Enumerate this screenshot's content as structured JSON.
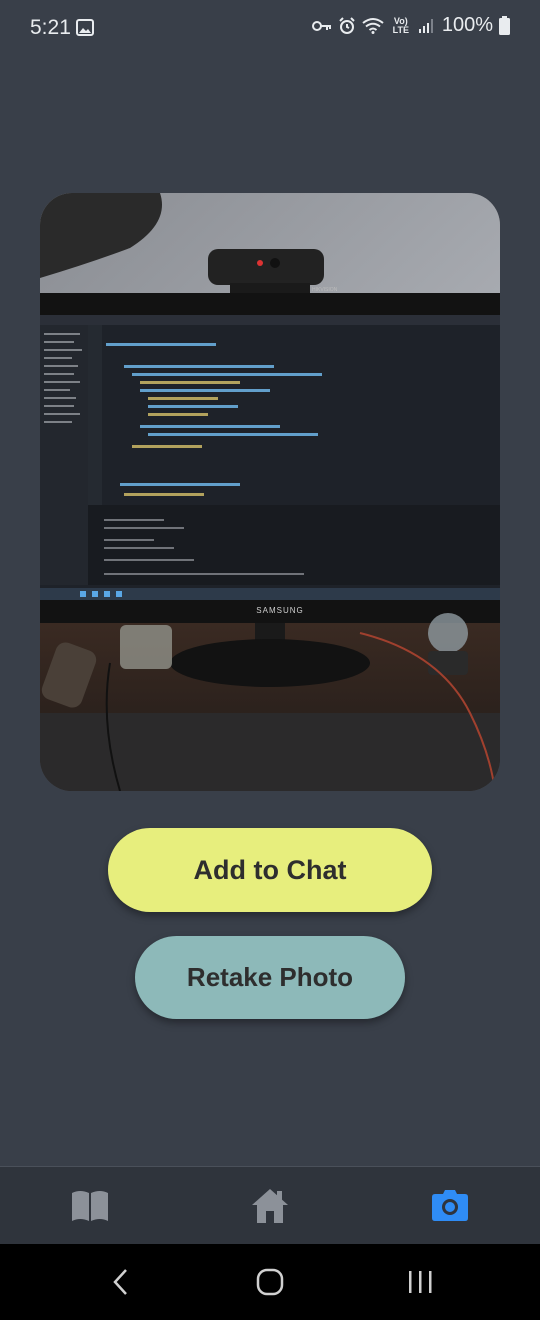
{
  "status_bar": {
    "time": "5:21",
    "network_label": "Vo) LTE",
    "battery_percent": "100%"
  },
  "photo": {
    "monitor_brand": "SAMSUNG",
    "webcam_brand": "HIKVISION"
  },
  "actions": {
    "add_to_chat": "Add to Chat",
    "retake_photo": "Retake Photo"
  },
  "tab_bar": {
    "tabs": [
      {
        "icon": "book-icon",
        "active": false
      },
      {
        "icon": "home-icon",
        "active": false
      },
      {
        "icon": "camera-icon",
        "active": true
      }
    ],
    "active_color": "#2f8cf5",
    "inactive_color": "#8c9199"
  },
  "colors": {
    "background": "#393f49",
    "add_button": "#e7ee7d",
    "retake_button": "#8db9b9"
  }
}
